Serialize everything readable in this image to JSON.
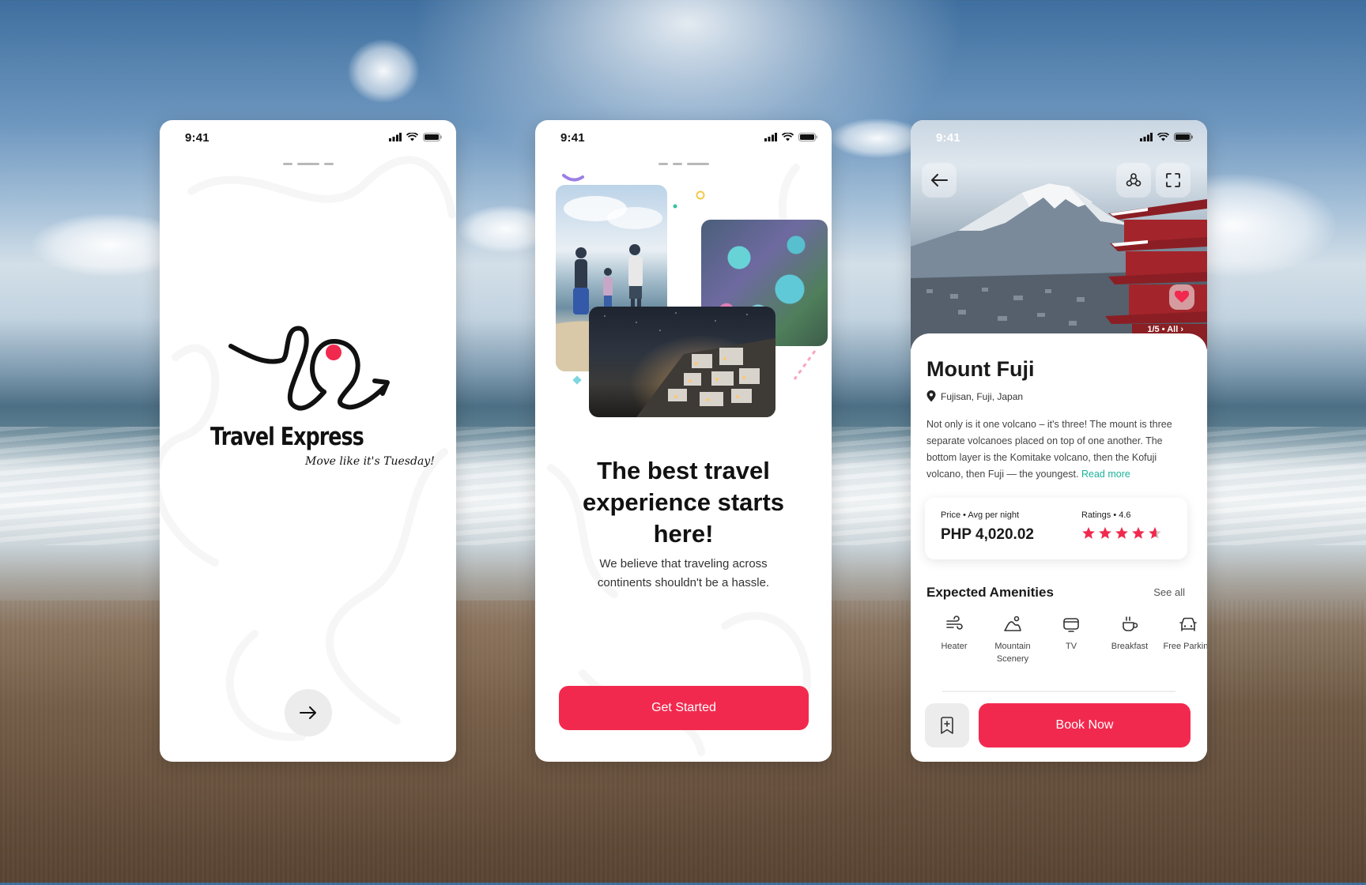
{
  "screen1": {
    "status_time": "9:41",
    "brand_name": "Travel Express",
    "tagline": "Move like it's Tuesday!",
    "next_icon": "arrow-right-icon"
  },
  "screen2": {
    "status_time": "9:41",
    "headline": "The best travel experience starts here!",
    "subtext": "We believe that traveling across continents shouldn't be a hassle.",
    "cta_label": "Get Started"
  },
  "screen3": {
    "status_time": "9:41",
    "gallery_count": "1/5 • All ›",
    "title": "Mount Fuji",
    "location": "Fujisan, Fuji, Japan",
    "description": "Not only is it one volcano – it's three! The mount is three separate volcanoes placed on top of one another. The bottom layer is the Komitake volcano, then the Kofuji volcano, then Fuji — the youngest.",
    "read_more": "Read more",
    "price_label": "Price • Avg per night",
    "price_value": "PHP 4,020.02",
    "ratings_label": "Ratings • 4.6",
    "rating": 4.6,
    "amenities_title": "Expected Amenities",
    "see_all": "See all",
    "amenities": [
      {
        "label": "Heater",
        "icon": "wind-icon"
      },
      {
        "label": "Mountain Scenery",
        "icon": "mountain-icon"
      },
      {
        "label": "TV",
        "icon": "tv-icon"
      },
      {
        "label": "Breakfast",
        "icon": "coffee-cup-icon"
      },
      {
        "label": "Free Parking",
        "icon": "car-icon"
      }
    ],
    "book_label": "Book Now"
  },
  "colors": {
    "accent": "#f2294e",
    "link": "#1bb39b",
    "star": "#f2294e"
  }
}
